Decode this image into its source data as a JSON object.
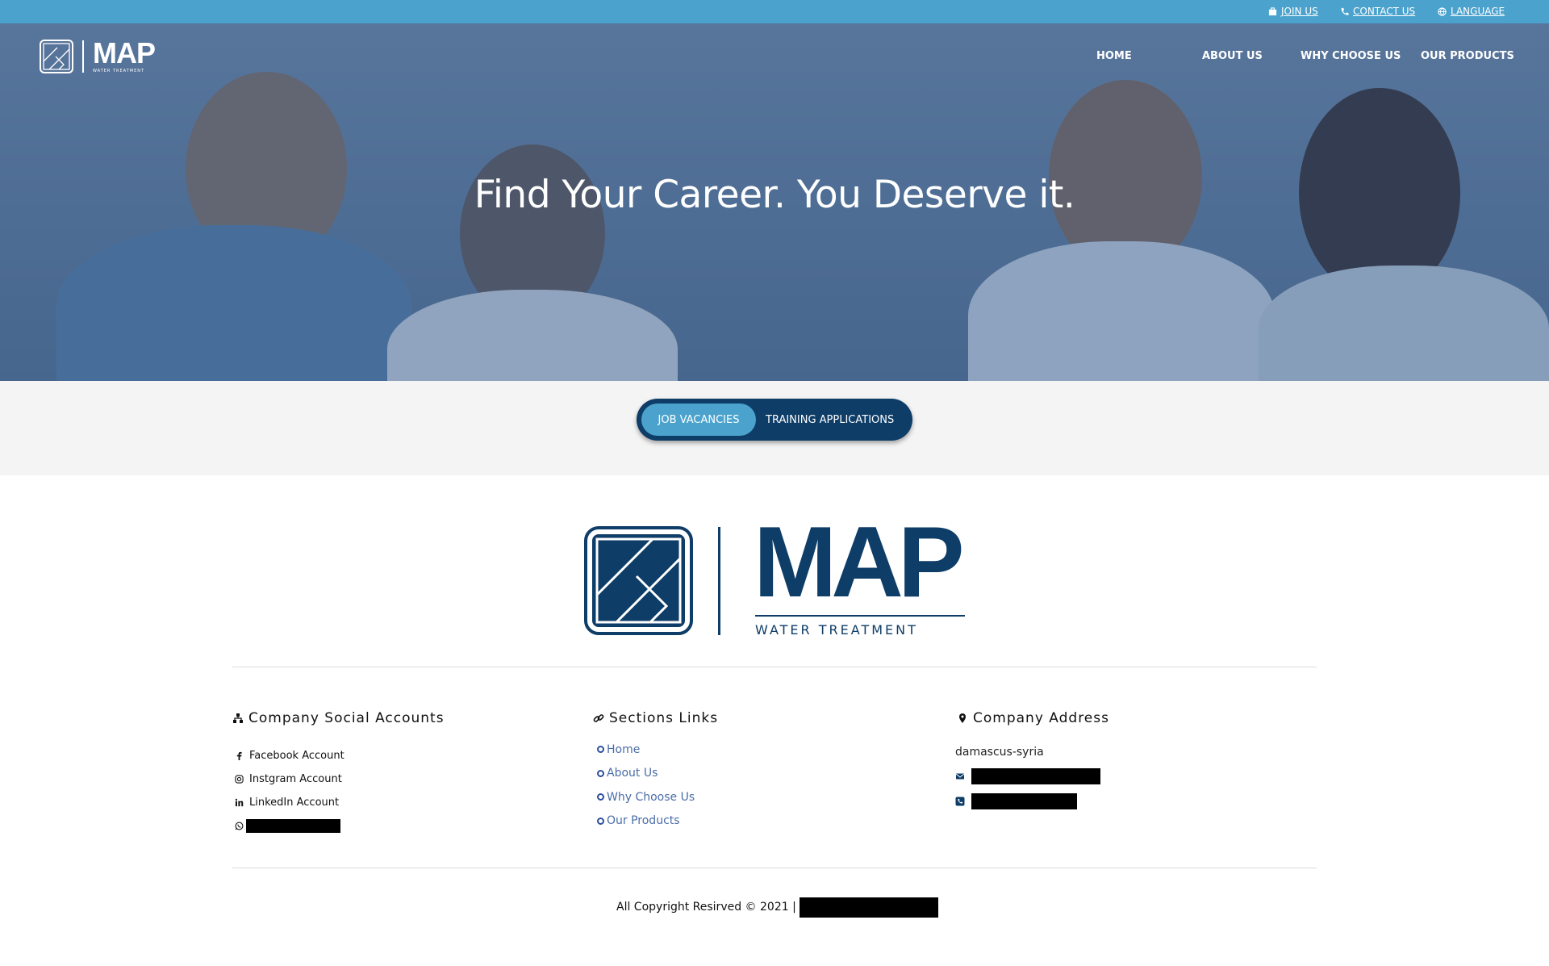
{
  "top_bar": {
    "join_label": "JOIN US",
    "contact_label": "CONTACT US",
    "language_label": "LANGUAGE",
    "color": "#4ba3cd"
  },
  "brand": {
    "name": "MAP",
    "tagline_small": "WATER TREATMENT",
    "tagline": "WATER TREATMENT",
    "color": "#0e3d68"
  },
  "nav": {
    "items": [
      "HOME",
      "ABOUT US",
      "WHY CHOOSE US",
      "OUR PRODUCTS"
    ]
  },
  "hero": {
    "title": "Find Your Career. You Deserve it."
  },
  "tabs": {
    "active": "JOB VACANCIES",
    "inactive": "TRAINING APPLICATIONS"
  },
  "footer": {
    "social": {
      "heading": "Company Social Accounts",
      "items": [
        "Facebook Account",
        "Instgram Account",
        "LinkedIn Account"
      ]
    },
    "sections": {
      "heading": "Sections Links",
      "items": [
        "Home",
        "About Us",
        "Why Choose Us",
        "Our Products"
      ]
    },
    "address": {
      "heading": "Company Address",
      "city": "damascus-syria"
    },
    "copyright": "All Copyright Resirved © 2021 |"
  },
  "icons": {
    "join": "briefcase-icon",
    "contact": "phone-icon",
    "language": "globe-icon",
    "social_heading": "network-icon",
    "sections_heading": "link-icon",
    "address_heading": "map-pin-icon",
    "facebook": "facebook-icon",
    "instagram": "instagram-icon",
    "linkedin": "linkedin-icon",
    "whatsapp": "whatsapp-icon",
    "email": "envelope-icon",
    "phone": "phone-square-icon"
  }
}
